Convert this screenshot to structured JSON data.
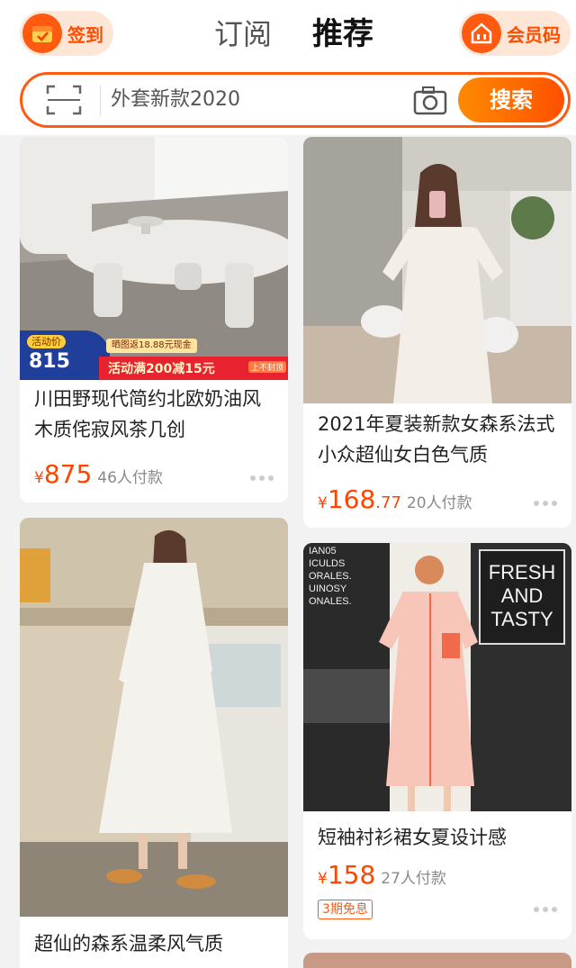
{
  "header": {
    "checkin_label": "签到",
    "tabs": [
      {
        "label": "订阅",
        "active": false
      },
      {
        "label": "推荐",
        "active": true
      }
    ],
    "member_label": "会员码",
    "accent_color": "#ff5a10"
  },
  "search": {
    "placeholder": "外套新款2020",
    "button_label": "搜索"
  },
  "cards": [
    {
      "title": "川田野现代简约北欧奶油风木质侘寂风茶几创",
      "price_currency": "¥",
      "price_int": "875",
      "price_dec": "",
      "paid": "46人付款",
      "promo": {
        "tag": "活动价",
        "price": "815",
        "note": "晒图返18.88元现金",
        "bar_text": "活动满200减15元",
        "bar_badge": "上不封顶"
      }
    },
    {
      "title": "2021年夏装新款女森系法式小众超仙女白色气质",
      "price_currency": "¥",
      "price_int": "168",
      "price_dec": ".77",
      "paid": "20人付款"
    },
    {
      "title": "超仙的森系温柔风气质",
      "price_currency": "",
      "price_int": "",
      "price_dec": "",
      "paid": ""
    },
    {
      "title": "短袖衬衫裙女夏设计感",
      "price_currency": "¥",
      "price_int": "158",
      "price_dec": "",
      "paid": "27人付款",
      "badge": "3期免息",
      "sign_text": [
        "FRESH",
        "AND",
        "TASTY"
      ],
      "wall_text": [
        "IAN05",
        "ICULDS",
        "ORALES.",
        "UINOSY",
        "ONALES."
      ]
    }
  ]
}
